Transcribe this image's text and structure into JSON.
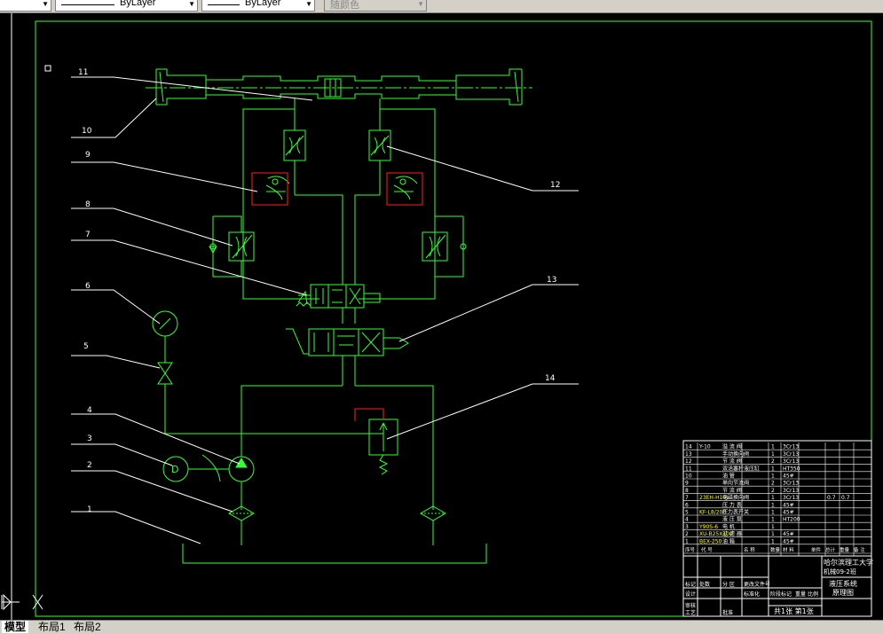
{
  "toolbar": {
    "linetype_value": "ByLayer",
    "lineweight_value": "ByLayer",
    "plotstyle_value": "随颜色"
  },
  "callouts": [
    "1",
    "2",
    "3",
    "4",
    "5",
    "6",
    "7",
    "8",
    "9",
    "10",
    "11",
    "12",
    "13",
    "14"
  ],
  "title_block": {
    "university": "哈尔滨理工大学",
    "class": "机械09-2班",
    "drawing_title_1": "液压系统",
    "drawing_title_2": "原理图",
    "sheets": "共1张  第1张",
    "designer_label": "设计",
    "approve_label": "批准",
    "check_label": "审核",
    "craft_label": "工艺",
    "stage_label": "阶段标记",
    "weight_label": "重量",
    "scale_label": "比例",
    "mark_label": "标记",
    "count_label": "处数",
    "zone_label": "分 区",
    "change_label": "更改文件号",
    "sign_label": "签名",
    "date_label": "年月日",
    "standardize_label": "标准化"
  },
  "bom_header": [
    "序号",
    "代 号",
    "名 称",
    "数量",
    "材 料",
    "单件",
    "总计",
    "重量",
    "备 注"
  ],
  "bom_rows": [
    {
      "no": "14",
      "code": "Y-10",
      "name": "溢 流 阀",
      "qty": "1",
      "mat": "3Cr13",
      "w1": "",
      "w2": ""
    },
    {
      "no": "13",
      "code": "",
      "name": "手动换向阀",
      "qty": "1",
      "mat": "3Cr13",
      "w1": "",
      "w2": ""
    },
    {
      "no": "12",
      "code": "",
      "name": "节 流 阀",
      "qty": "2",
      "mat": "3Cr13",
      "w1": "",
      "w2": ""
    },
    {
      "no": "11",
      "code": "",
      "name": "双活塞杆液压缸",
      "qty": "1",
      "mat": "HT350",
      "w1": "",
      "w2": ""
    },
    {
      "no": "10",
      "code": "",
      "name": "油  管",
      "qty": "1",
      "mat": "45#",
      "w1": "",
      "w2": ""
    },
    {
      "no": "9",
      "code": "",
      "name": "单向节流阀",
      "qty": "2",
      "mat": "3Cr13",
      "w1": "",
      "w2": ""
    },
    {
      "no": "8",
      "code": "",
      "name": "节 流 阀",
      "qty": "2",
      "mat": "3Cr13",
      "w1": "",
      "w2": ""
    },
    {
      "no": "7",
      "code": "23EH-H10L",
      "name": "电磁换向阀",
      "qty": "1",
      "mat": "3Cr13",
      "w1": "0.7",
      "w2": "0.7"
    },
    {
      "no": "6",
      "code": "",
      "name": "压 力 表",
      "qty": "1",
      "mat": "45#",
      "w1": "",
      "w2": ""
    },
    {
      "no": "5",
      "code": "KF-L8/20E",
      "name": "压力表开关",
      "qty": "1",
      "mat": "45#",
      "w1": "",
      "w2": ""
    },
    {
      "no": "4",
      "code": "",
      "name": "液 压 泵",
      "qty": "1",
      "mat": "HT200",
      "w1": "",
      "w2": ""
    },
    {
      "no": "3",
      "code": "Y90S-6",
      "name": "电  机",
      "qty": "1",
      "mat": "",
      "w1": "",
      "w2": ""
    },
    {
      "no": "2",
      "code": "XU-B25X100",
      "name": "过 滤 器",
      "qty": "1",
      "mat": "45#",
      "w1": "",
      "w2": ""
    },
    {
      "no": "1",
      "code": "BEX-250",
      "name": "油  箱",
      "qty": "1",
      "mat": "45#",
      "w1": "",
      "w2": ""
    }
  ],
  "tabs": [
    "模型",
    "布局1",
    "布局2"
  ],
  "colors": {
    "green": "#33ff33",
    "red": "#ff2020",
    "yellow": "#ffff00",
    "white": "#ffffff"
  }
}
